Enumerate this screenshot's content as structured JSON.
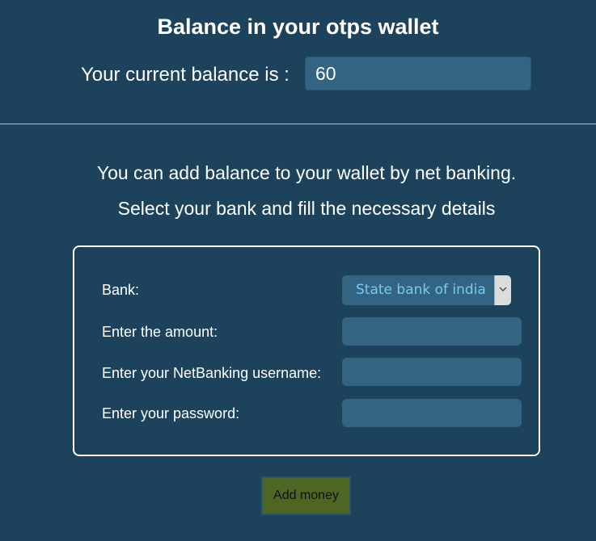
{
  "header": {
    "title": "Balance in your otps wallet",
    "balance_label": "Your current balance is :",
    "balance_value": "60"
  },
  "info": {
    "line1": "You can add balance to your wallet by net banking.",
    "line2": "Select your bank and fill the necessary details"
  },
  "form": {
    "bank_label": "Bank:",
    "bank_selected": "State bank of india",
    "amount_label": "Enter the amount:",
    "amount_value": "",
    "username_label": "Enter your NetBanking username:",
    "username_value": "",
    "password_label": "Enter your password:",
    "password_value": "",
    "select_icon": "chevron-down-icon"
  },
  "actions": {
    "add_money_label": "Add money"
  },
  "colors": {
    "background": "#1c425c",
    "input_background": "#336482",
    "select_text": "#79c9f2",
    "button_background": "#4d6624",
    "divider": "#c9c4a6"
  }
}
